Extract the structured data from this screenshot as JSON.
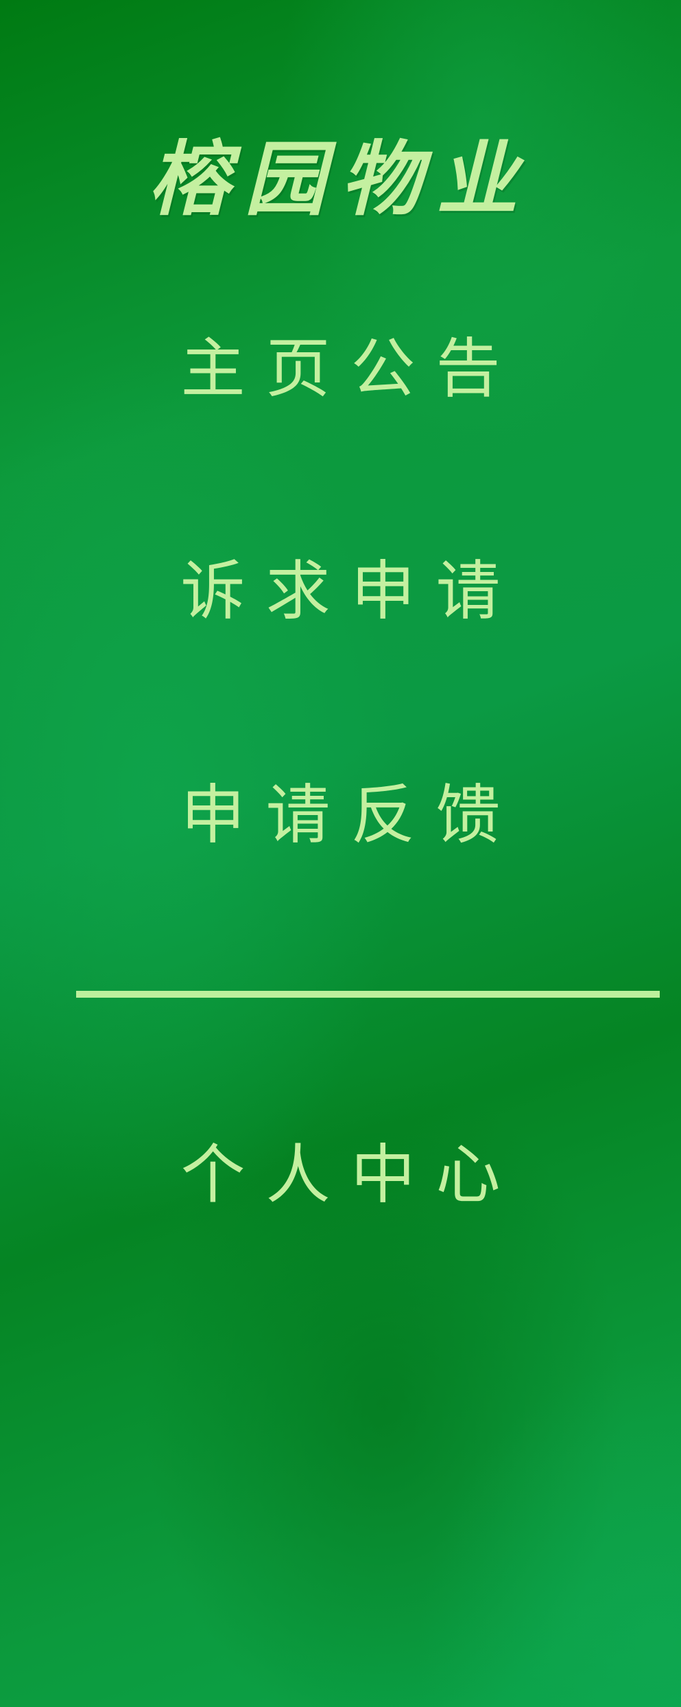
{
  "app": {
    "brand_title": "榕园物业"
  },
  "nav": {
    "items": [
      {
        "label": "主页公告"
      },
      {
        "label": "诉求申请"
      },
      {
        "label": "申请反馈"
      },
      {
        "label": "个人中心"
      }
    ]
  },
  "colors": {
    "text": "#c4f0a0",
    "divider": "#bdf09d",
    "background_dark": "#007a12",
    "background_light": "#0ba44b"
  }
}
